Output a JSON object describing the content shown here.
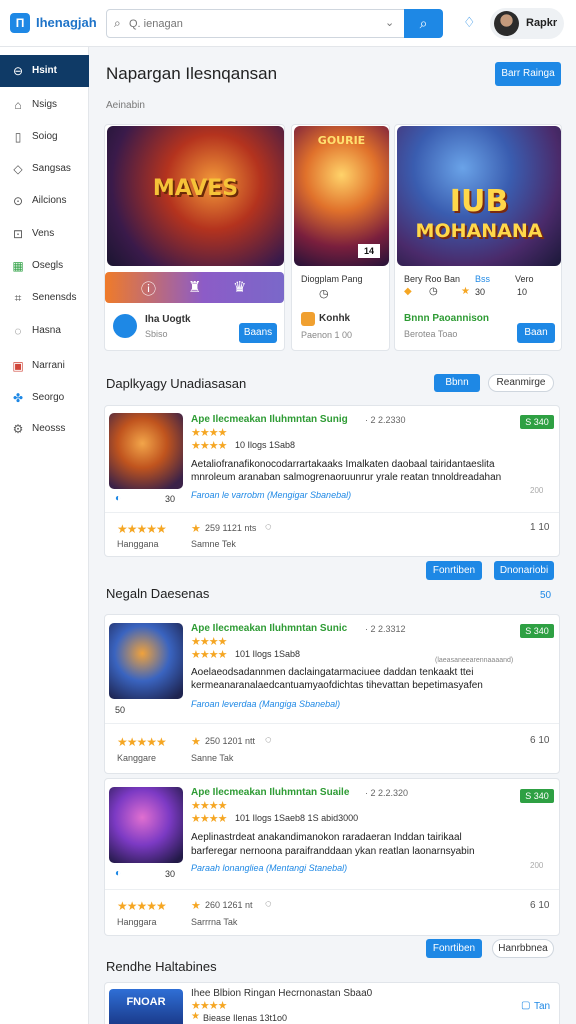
{
  "header": {
    "logo_text": "П",
    "app_title": "Ihenagjah",
    "search_placeholder": "Q. ienagan",
    "user_name": "Rapkr"
  },
  "sidebar": {
    "items": [
      {
        "label": "Hsint",
        "icon": "home-icon",
        "active": true
      },
      {
        "label": "Nsigs",
        "icon": "house-icon"
      },
      {
        "label": "Soiog",
        "icon": "book-icon"
      },
      {
        "label": "Sangsas",
        "icon": "bag-icon"
      },
      {
        "label": "Ailcions",
        "icon": "chat-icon"
      },
      {
        "label": "Vens",
        "icon": "tag-icon"
      },
      {
        "label": "Osegls",
        "icon": "grid-icon"
      },
      {
        "label": "Senensds",
        "icon": "share-icon"
      },
      {
        "label": "Hasna",
        "icon": "chat-bubble-icon"
      },
      {
        "label": "Narrani",
        "icon": "calendar-icon"
      },
      {
        "label": "Seorgo",
        "icon": "color-puzzle-icon"
      },
      {
        "label": "Neosss",
        "icon": "settings-icon"
      }
    ]
  },
  "main": {
    "title": "Napargan Ilesnqansan",
    "top_button": "Barr Rainga",
    "subtitle": "Aeinabin",
    "featured": {
      "card1": {
        "art_text": "MAVES",
        "game_name": "Iha Uogtk",
        "game_sub": "Sbiso",
        "button": "Baans"
      },
      "card2": {
        "art_text": "GOURIE",
        "art_badge": "14",
        "meta1": "Diogplam Pang",
        "meta2_name": "Konhk",
        "meta2_sub": "Paenon 1 00"
      },
      "card3": {
        "art_text_1": "IUB",
        "art_text_2": "MOHANANA",
        "meta_a": "Bery Roo Ban",
        "meta_b": "Bss",
        "meta_c": "Vero",
        "val_a": "30",
        "val_b": "10",
        "game_name": "Bnnn Paoannison",
        "game_sub": "Berotea Toao",
        "button": "Baan"
      }
    },
    "section1": {
      "title": "Daplkyagy Unadiasasan",
      "btn_primary": "Bbnn",
      "btn_outline": "Reanmirge"
    },
    "item1": {
      "title": "Ape Ilecmeakan Iluhmntan Sunig",
      "date": "· 2 2.2330",
      "badge": "S 340",
      "meta": "10 Ilogs 1Sab8",
      "desc_1": "Aetaliofranafikonocodarrartakaaks Imalkaten daobaal tairidantaeslita",
      "desc_2": "mnroleum aranaban salmogrenaoruunrur yrale reatan tnnoldreadahan",
      "link": "Faroan le varrobm (Mengigar Sbanebal)",
      "thumb_num": "30",
      "rating_text": "259 1121 nts",
      "count": "1 10",
      "label_left": "Hanggana",
      "label_right": "Samne Tek",
      "side_badge": "200"
    },
    "actions1": {
      "primary": "Fonrtiben",
      "secondary": "Dnonariobi"
    },
    "section2": {
      "title": "Negaln Daesenas",
      "count": "50"
    },
    "item2": {
      "title": "Ape Ilecmeakan Iluhmntan Sunic",
      "date": "· 2 2.3312",
      "badge": "S 340",
      "meta": "101 Ilogs 1Sab8",
      "desc_1": "Aoelaeodsadannmen daclaingatarmaciuee daddan tenkaakt ttei",
      "desc_2": "kermeanaranalaedcantuamyaofdichtas tihevattan bepetimasyafen",
      "link": "Faroan leverdaa (Mangiga Sbanebal)",
      "thumb_num": "50",
      "rating_text": "250 1201 ntt",
      "count": "6 10",
      "label_left": "Kanggare",
      "label_right": "Sanne Tak",
      "side_badge": "(laeasaneearennaaaand)"
    },
    "item3": {
      "title": "Ape Ilecmeakan Iluhmntan Suaile",
      "date": "· 2 2.2.320",
      "badge": "S 340",
      "meta": "101 Ilogs 1Saeb8 1S abid3000",
      "desc_1": "Aeplinastrdeat anakandimanokon raradaeran Inddan tairikaal",
      "desc_2": "barferegar nernoona paraifranddaan ykan reatlan laonarnsyabin",
      "link": "Paraah lonangliea (Mentangi Stanebal)",
      "thumb_num": "30",
      "rating_text": "260 1261 nt",
      "count": "6 10",
      "label_left": "Hanggara",
      "label_right": "Sarrrna Tak",
      "side_badge": "200"
    },
    "actions2": {
      "primary": "Fonrtiben",
      "secondary": "Hanrbbnea"
    },
    "section3": {
      "title": "Rendhe Haltabines"
    },
    "item4": {
      "thumb_text": "FNOAR",
      "title": "Ihee Blbion Ringan Hecrnonastan Sbaa0",
      "meta": "Biease Ilenas 13t1o0",
      "link": "Tan"
    }
  }
}
